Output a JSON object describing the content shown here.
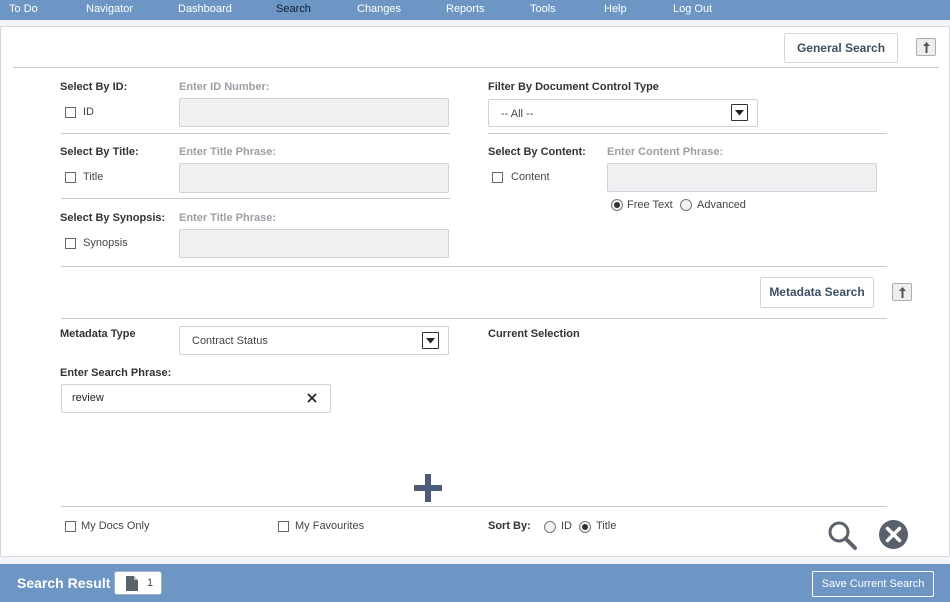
{
  "nav": {
    "items": [
      "To Do",
      "Navigator",
      "Dashboard",
      "Search",
      "Changes",
      "Reports",
      "Tools",
      "Help",
      "Log Out"
    ],
    "active": "Search"
  },
  "general_search": {
    "button_label": "General Search",
    "select_by_id": {
      "label": "Select By ID:",
      "checkbox_label": "ID",
      "input_label": "Enter ID Number:",
      "value": ""
    },
    "filter_doc_type": {
      "label": "Filter By Document Control Type",
      "selected": "-- All --"
    },
    "select_by_title": {
      "label": "Select By Title:",
      "checkbox_label": "Title",
      "input_label": "Enter Title Phrase:",
      "value": ""
    },
    "select_by_content": {
      "label": "Select By Content:",
      "checkbox_label": "Content",
      "input_label": "Enter Content Phrase:",
      "value": "",
      "options": [
        "Free Text",
        "Advanced"
      ],
      "selected_option": "Free Text"
    },
    "select_by_synopsis": {
      "label": "Select By Synopsis:",
      "checkbox_label": "Synopsis",
      "input_label": "Enter Title Phrase:",
      "value": ""
    }
  },
  "metadata_search": {
    "button_label": "Metadata Search",
    "type_label": "Metadata Type",
    "type_selected": "Contract Status",
    "current_selection_label": "Current Selection",
    "phrase_label": "Enter Search Phrase:",
    "phrase_value": "review"
  },
  "footer_options": {
    "my_docs_only": "My Docs Only",
    "my_favourites": "My Favourites",
    "sort_by_label": "Sort By:",
    "sort_options": [
      "ID",
      "Title"
    ],
    "sort_selected": "Title"
  },
  "result_bar": {
    "title": "Search Result",
    "count": "1",
    "save_button": "Save Current Search"
  },
  "colors": {
    "nav_bg": "#6d96c4",
    "accent_dark": "#4d5a78",
    "icon_gray": "#59616b"
  },
  "icons": [
    "collapse-icon",
    "dropdown-arrow-icon",
    "clear-icon",
    "add-icon",
    "search-icon",
    "cancel-icon",
    "document-icon"
  ]
}
